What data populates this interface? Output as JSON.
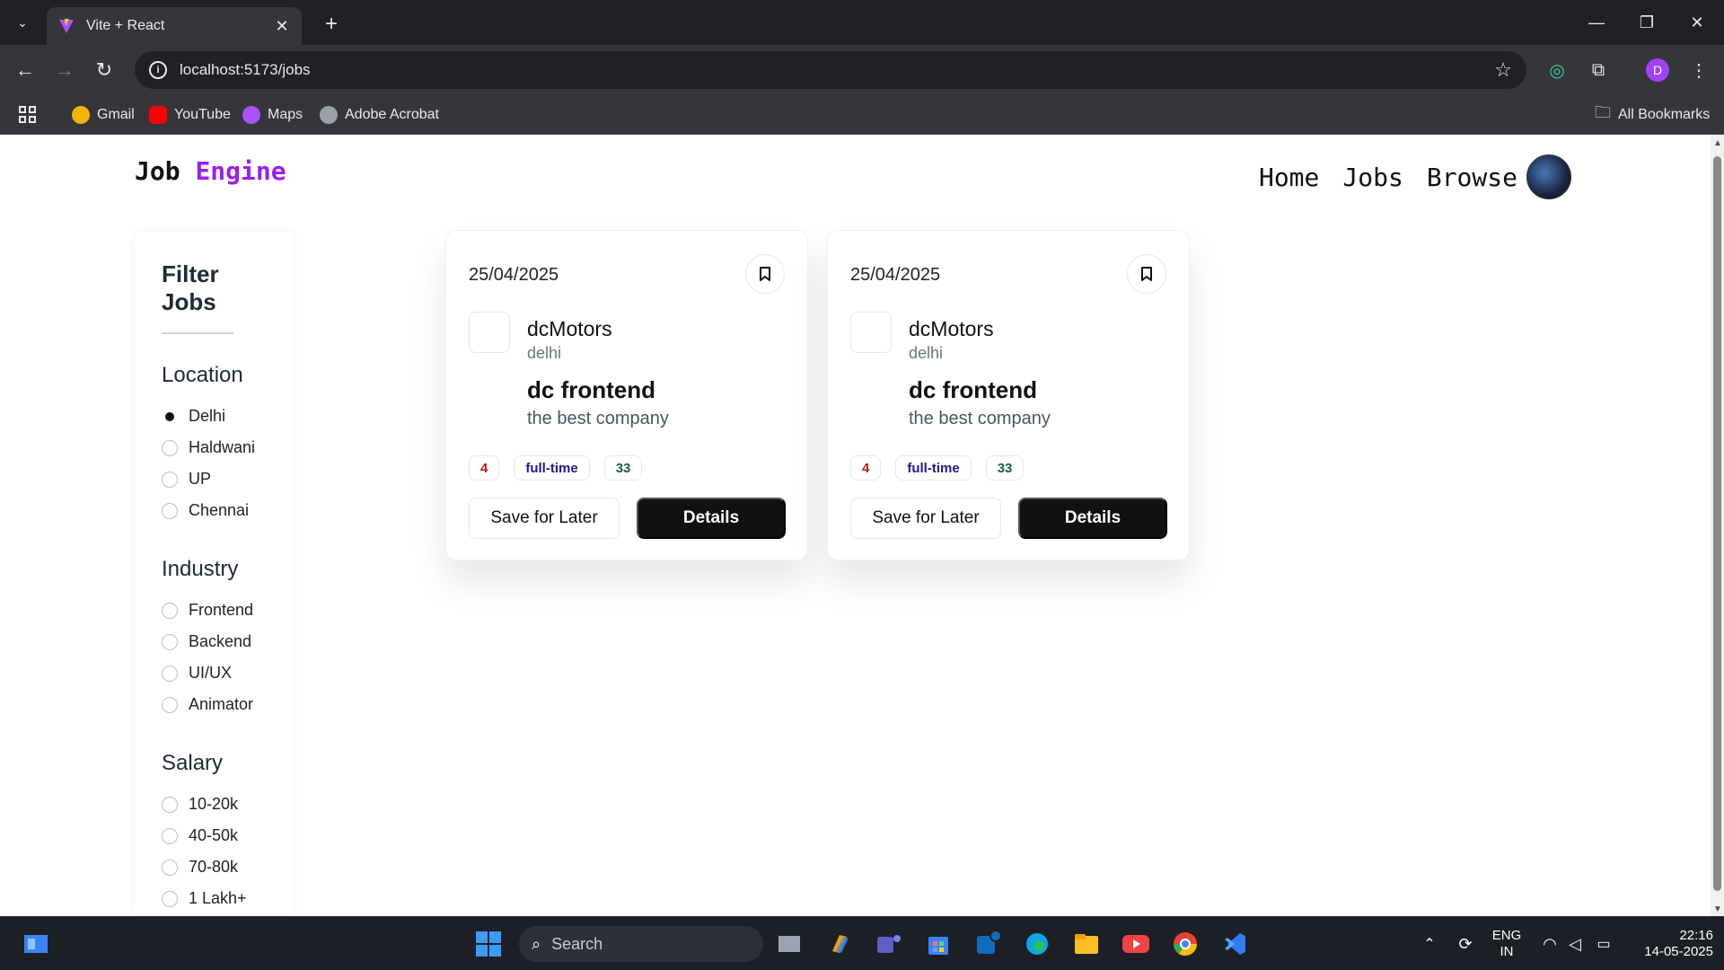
{
  "browser": {
    "tab_title": "Vite + React",
    "url": "localhost:5173/jobs",
    "bookmarks": [
      "Gmail",
      "YouTube",
      "Maps",
      "Adobe Acrobat"
    ],
    "all_bookmarks": "All Bookmarks",
    "profile_initial": "D"
  },
  "app": {
    "logo_part1": "Job",
    "logo_part2": "Engine",
    "accent_color": "#9b1fe8",
    "nav": [
      "Home",
      "Jobs",
      "Browse"
    ]
  },
  "filter": {
    "title": "Filter Jobs",
    "groups": [
      {
        "title": "Location",
        "options": [
          "Delhi",
          "Haldwani",
          "UP",
          "Chennai"
        ],
        "selected": "Delhi"
      },
      {
        "title": "Industry",
        "options": [
          "Frontend",
          "Backend",
          "UI/UX",
          "Animator"
        ],
        "selected": null
      },
      {
        "title": "Salary",
        "options": [
          "10-20k",
          "40-50k",
          "70-80k",
          "1 Lakh+"
        ],
        "selected": null
      }
    ]
  },
  "jobs": [
    {
      "date": "25/04/2025",
      "company": "dcMotors",
      "location": "delhi",
      "title": "dc frontend",
      "description": "the best company",
      "badges": [
        "4",
        "full-time",
        "33"
      ],
      "save_label": "Save for Later",
      "details_label": "Details"
    },
    {
      "date": "25/04/2025",
      "company": "dcMotors",
      "location": "delhi",
      "title": "dc frontend",
      "description": "the best company",
      "badges": [
        "4",
        "full-time",
        "33"
      ],
      "save_label": "Save for Later",
      "details_label": "Details"
    }
  ],
  "taskbar": {
    "search_placeholder": "Search",
    "lang_line1": "ENG",
    "lang_line2": "IN",
    "time": "22:16",
    "date": "14-05-2025"
  }
}
